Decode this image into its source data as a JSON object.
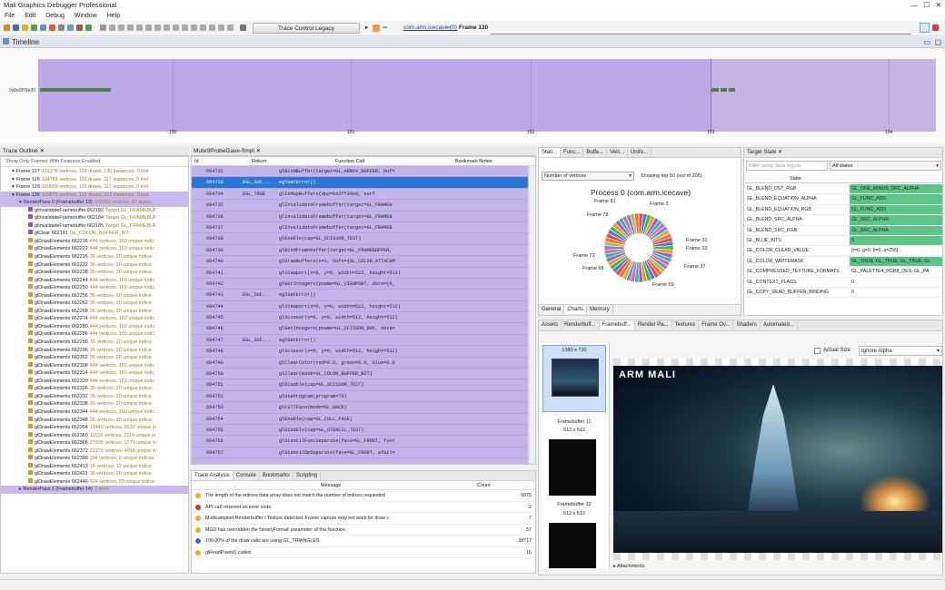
{
  "app": {
    "title": "Mali Graphics Debugger Professional"
  },
  "menu": [
    "File",
    "Edit",
    "Debug",
    "Window",
    "Help"
  ],
  "toolbar": {
    "trace_button": "Trace Control Legacy",
    "device": "com.arm.icecave (0)",
    "frame": "Frame 130"
  },
  "timeline": {
    "title": "Timeline",
    "row_label": "0x8e0f79e30",
    "ticks": [
      "150",
      "151",
      "152",
      "153",
      "154"
    ]
  },
  "trace_outline": {
    "title": "Trace Outline",
    "filter_label": "Show Only Frames With Features Enabled",
    "rows": [
      {
        "text": "Frame 127",
        "detail": "131278 vertices, 119 draws, 120 instances, 0 inst",
        "sel": false
      },
      {
        "text": "Frame 128",
        "detail": "104781 vertices, 115 draws, 117 instances, 0 inst",
        "sel": false
      },
      {
        "text": "Frame 129",
        "detail": "100003 vertices, 115 draws, 117 instances, 0 inst",
        "sel": false
      },
      {
        "text": "Frame 130",
        "detail": "100579 vertices, 113 draws, 103 instances, 0 inst",
        "sel": true
      },
      {
        "text": "RenderPass 0 (Framebuffer 13)",
        "detail": "100792 vertices, 83 draws",
        "sel": true
      },
      {
        "text": "glInvalidateFramebuffer 662182",
        "detail": "Target GL_FRAMEBUF",
        "sel": false
      },
      {
        "text": "glInvalidateFramebuffer 662184",
        "detail": "Target GL_FRAMEBUF",
        "sel": false
      },
      {
        "text": "glInvalidateFramebuffer 662185",
        "detail": "Target GL_FRAMEBUF",
        "sel": false
      },
      {
        "text": "glClear 662191",
        "detail": "GL_COLOR_BUFFER_BIT",
        "sel": false
      },
      {
        "text": "glDrawElements 662216",
        "detail": "444 vertices, 160 unique indic",
        "sel": false
      },
      {
        "text": "glDrawElements 662222",
        "detail": "444 vertices, 163 unique indic",
        "sel": false
      },
      {
        "text": "glDrawElements 662226",
        "detail": "36 vertices, 20 unique indice",
        "sel": false
      },
      {
        "text": "glDrawElements 662232",
        "detail": "36 vertices, 20 unique indice",
        "sel": false
      },
      {
        "text": "glDrawElements 662238",
        "detail": "36 vertices, 20 unique indice",
        "sel": false
      },
      {
        "text": "glDrawElements 662244",
        "detail": "444 vertices, 160 unique indic",
        "sel": false
      },
      {
        "text": "glDrawElements 662250",
        "detail": "444 vertices, 163 unique indic",
        "sel": false
      },
      {
        "text": "glDrawElements 662256",
        "detail": "36 vertices, 20 unique indice",
        "sel": false
      },
      {
        "text": "glDrawElements 662262",
        "detail": "36 vertices, 20 unique indice",
        "sel": false
      },
      {
        "text": "glDrawElements 662268",
        "detail": "36 vertices, 20 unique indice",
        "sel": false
      },
      {
        "text": "glDrawElements 662274",
        "detail": "444 vertices, 163 unique indic",
        "sel": false
      },
      {
        "text": "glDrawElements 662280",
        "detail": "444 vertices, 163 unique indic",
        "sel": false
      },
      {
        "text": "glDrawElements 662286",
        "detail": "444 vertices, 163 unique indic",
        "sel": false
      },
      {
        "text": "glDrawElements 662290",
        "detail": "36 vertices, 20 unique indice",
        "sel": false
      },
      {
        "text": "glDrawElements 662296",
        "detail": "36 vertices, 20 unique indice",
        "sel": false
      },
      {
        "text": "glDrawElements 662302",
        "detail": "36 vertices, 20 unique indice",
        "sel": false
      },
      {
        "text": "glDrawElements 662308",
        "detail": "444 vertices, 163 unique indic",
        "sel": false
      },
      {
        "text": "glDrawElements 662314",
        "detail": "444 vertices, 163 unique indic",
        "sel": false
      },
      {
        "text": "glDrawElements 662320",
        "detail": "444 vertices, 163 unique indic",
        "sel": false
      },
      {
        "text": "glDrawElements 662326",
        "detail": "36 vertices, 20 unique indice",
        "sel": false
      },
      {
        "text": "glDrawElements 662332",
        "detail": "36 vertices, 20 unique indice",
        "sel": false
      },
      {
        "text": "glDrawElements 662338",
        "detail": "36 vertices, 20 unique indice",
        "sel": false
      },
      {
        "text": "glDrawElements 662344",
        "detail": "444 vertices, 160 unique indic",
        "sel": false
      },
      {
        "text": "glDrawElements 662348",
        "detail": "36 vertices, 20 unique indice",
        "sel": false
      },
      {
        "text": "glDrawElements 662354",
        "detail": "13440 vertices, 2633 unique in",
        "sel": false
      },
      {
        "text": "glDrawElements 662360",
        "detail": "11016 vertices, 2114 unique in",
        "sel": false
      },
      {
        "text": "glDrawElements 662366",
        "detail": "27030 vertices, 2770 unique in",
        "sel": false
      },
      {
        "text": "glDrawElements 662372",
        "detail": "22272 vertices, 4018 unique in",
        "sel": false
      },
      {
        "text": "glDrawElements 662399",
        "detail": "204 vertices, 0 unique indices",
        "sel": false
      },
      {
        "text": "glDrawElements 662413",
        "detail": "18 vertices, 12 unique indice",
        "sel": false
      },
      {
        "text": "glDrawElements 662421",
        "detail": "36 vertices, 20 unique indice",
        "sel": false
      },
      {
        "text": "glDrawElements 662446",
        "detail": "324 vertices, 20 unique indice",
        "sel": false
      },
      {
        "text": "RenderPass 1 (Framebuffer 14)",
        "detail": "1 draw",
        "sel": true
      }
    ]
  },
  "function_calls": {
    "title": "Mute9ProbeGave-fimpl",
    "headers": [
      "Id",
      "Return",
      "Function Call",
      "Bookmark Notes"
    ],
    "rows": [
      {
        "id": "664732",
        "ret": "",
        "call": "glBindBuffer(target=GL_ARRAY_BUFFER, buf="
      },
      {
        "id": "664733",
        "ret": "EGL_SUC...",
        "call": "eglGetError()"
      },
      {
        "id": "664734",
        "ret": "EGL_TRUE",
        "call": "glIsMapBuffers(dpy=0x2ff20e0, surf"
      },
      {
        "id": "664735",
        "ret": "",
        "call": "glInvalidateFramebuffer(target=GL_FRAMEB"
      },
      {
        "id": "664736",
        "ret": "",
        "call": "glInvalidateFramebuffer(target=GL_FRAMEB"
      },
      {
        "id": "664737",
        "ret": "",
        "call": "glInvalidateFramebuffer(target=GL_FRAMEB"
      },
      {
        "id": "664738",
        "ret": "",
        "call": "glEnable(cap=GL_SCISSOR_TEST)"
      },
      {
        "id": "664739",
        "ret": "",
        "call": "glBindFramebuffer(target=GL_FRAMEBUFFER,"
      },
      {
        "id": "664740",
        "ret": "",
        "call": "glDrawBuffers(n=1, bufs={GL_COLOR_ATTACHM"
      },
      {
        "id": "664741",
        "ret": "",
        "call": "glViewport(x=0, y=0, width=512, height=512)"
      },
      {
        "id": "664742",
        "ret": "",
        "call": "glGetIntegerv(pname=GL_VIEWPORT, data={0,"
      },
      {
        "id": "664743",
        "ret": "EGL_SUC...",
        "call": "eglGetError()"
      },
      {
        "id": "664744",
        "ret": "",
        "call": "glViewport(x=0, y=0, width=512, height=512)"
      },
      {
        "id": "664745",
        "ret": "",
        "call": "glScissor(x=0, y=0, width=512, height=512)"
      },
      {
        "id": "664746",
        "ret": "",
        "call": "glGetIntegerv(pname=GL_SCISSOR_BOX, data="
      },
      {
        "id": "664747",
        "ret": "EGL_SUC...",
        "call": "eglGetError()"
      },
      {
        "id": "664748",
        "ret": "",
        "call": "glScissor(x=0, y=0, width=512, height=512)"
      },
      {
        "id": "664749",
        "ret": "",
        "call": "glClearColor(red=0.0, green=0.0, blue=0.0"
      },
      {
        "id": "664750",
        "ret": "",
        "call": "glClear(mask=GL_COLOR_BUFFER_BIT)"
      },
      {
        "id": "664751",
        "ret": "",
        "call": "glDisable(cap=GL_SCISSOR_TEST)"
      },
      {
        "id": "664752",
        "ret": "",
        "call": "glUseProgram(program=70)"
      },
      {
        "id": "664753",
        "ret": "",
        "call": "glCullFace(mode=GL_BACK)"
      },
      {
        "id": "664754",
        "ret": "",
        "call": "glEnable(cap=GL_CULL_FACE)"
      },
      {
        "id": "664755",
        "ret": "",
        "call": "glDisable(cap=GL_STENCIL_TEST)"
      },
      {
        "id": "664756",
        "ret": "",
        "call": "glStencilFuncSeparate(face=GL_FRONT, func"
      },
      {
        "id": "664757",
        "ret": "",
        "call": "glStencilOpSeparate(face=GL_FRONT, sfail="
      }
    ]
  },
  "stats": {
    "tabs": [
      "Stati...",
      "Func...",
      "Buffe...",
      "Vert...",
      "Unifo..."
    ],
    "dropdown": "Number of vertices",
    "showing": "Showing top 50 (out of 205)",
    "title": "Process 0 (com.arm.icecave)",
    "labels": [
      "Frame 81",
      "Frame 3",
      "Frame 78",
      "Frame 31",
      "Frame 33",
      "Frame 72",
      "Frame 37",
      "Frame 68",
      "Frame 59"
    ],
    "bottom_tabs": [
      "General",
      "Charts",
      "Memory"
    ]
  },
  "target_state": {
    "title": "Target State",
    "filter_placeholder": "Filter using Java regula",
    "states_dropdown": "All states",
    "header": "State",
    "rows": [
      {
        "k": "GL_BLEND_DST_RGB",
        "v": "GL_ONE_MINUS_SRC_ALPHA",
        "hl": true
      },
      {
        "k": "GL_BLEND_EQUATION_ALPHA",
        "v": "GL_FUNC_ADD",
        "hl": true
      },
      {
        "k": "GL_BLEND_EQUATION_RGB",
        "v": "GL_FUNC_ADD",
        "hl": true
      },
      {
        "k": "GL_BLEND_SRC_ALPHA",
        "v": "GL_SRC_ALPHA",
        "hl": true
      },
      {
        "k": "GL_BLEND_SRC_RGB",
        "v": "GL_SRC_ALPHA",
        "hl": true
      },
      {
        "k": "GL_BLUE_BITS",
        "v": "5",
        "hl": true
      },
      {
        "k": "GL_COLOR_CLEAR_VALUE",
        "v": "[r=0, g=0, b=0, a=255]",
        "hl": false
      },
      {
        "k": "GL_COLOR_WRITEMASK",
        "v": "GL_TRUE, GL_TRUE, GL_TRUE, GL",
        "hl": true
      },
      {
        "k": "GL_COMPRESSED_TEXTURE_FORMATS",
        "v": "GL_PALETTE4_RGB8_OES, GL_PA",
        "hl": false
      },
      {
        "k": "GL_CONTEXT_FLAGS",
        "v": "0",
        "hl": false
      },
      {
        "k": "GL_COPY_READ_BUFFER_BINDING",
        "v": "0",
        "hl": false
      }
    ]
  },
  "trace_analysis": {
    "tabs": [
      "Trace Analysis",
      "Console",
      "Bookmarks",
      "Scripting"
    ],
    "headers": [
      "Message",
      "Count"
    ],
    "rows": [
      {
        "type": "warning",
        "msg": "The length of the indices data array does not match the number of indices requested",
        "count": "5875"
      },
      {
        "type": "error",
        "msg": "API call returned an error code.",
        "count": "2"
      },
      {
        "type": "warning",
        "msg": "Multisampled Renderbuffer / Texture detected. Frame capture may not work for draw c",
        "count": "7"
      },
      {
        "type": "warning",
        "msg": "MGD has overridden the 'binaryFormat' parameter of this function.",
        "count": "57"
      },
      {
        "type": "info",
        "msg": "100.00% of the draw calls are using GL_TRIANGLES.",
        "count": "38717"
      },
      {
        "type": "warning",
        "msg": "glReadPixels() called.",
        "count": "16"
      }
    ]
  },
  "bottom_right": {
    "tabs": [
      "Assets",
      "Renderbuff...",
      "Framebuff...",
      "Render Pa...",
      "Textures",
      "Frame Ov...",
      "Shaders",
      "Automated..."
    ],
    "fb_items": [
      {
        "name": "",
        "size": "1280 x 720"
      },
      {
        "name": "Framebuffer 11",
        "size": "512 x 512"
      },
      {
        "name": "Framebuffer 12",
        "size": "512 x 512"
      }
    ],
    "actual_size_label": "Actual Size",
    "alpha_dropdown": "Ignore Alpha",
    "logo": "ARM MALI",
    "attachments_label": "Attachments"
  }
}
